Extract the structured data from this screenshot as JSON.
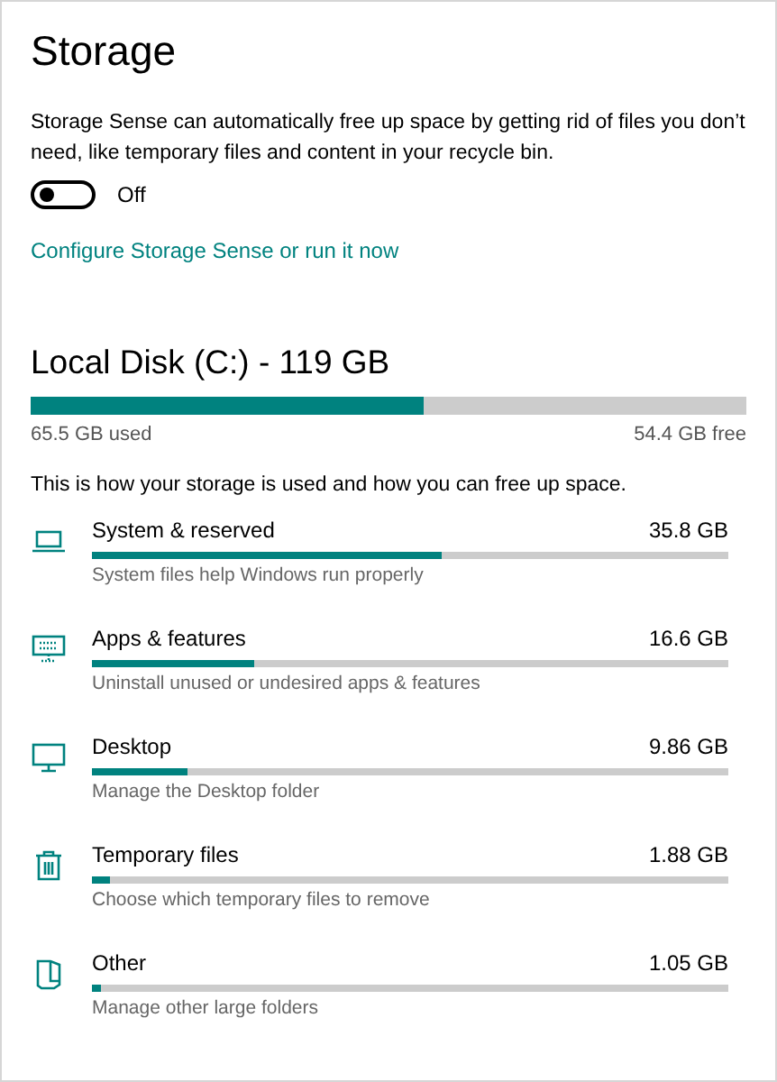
{
  "title": "Storage",
  "storage_sense": {
    "description": "Storage Sense can automatically free up space by getting rid of files you don’t need, like temporary files and content in your recycle bin.",
    "toggle": {
      "on": false,
      "label": "Off"
    },
    "link": "Configure Storage Sense or run it now"
  },
  "disk": {
    "title": "Local Disk (C:) - 119 GB",
    "level": 0.55,
    "used": "65.5 GB used",
    "free": "54.4 GB free",
    "description": "This is how your storage is used and how you can free up space."
  },
  "categories": [
    {
      "kind": "laptop",
      "name": "System & reserved",
      "size": "35.8 GB",
      "level": 0.55,
      "description": "System files help Windows run properly"
    },
    {
      "kind": "keyboard-monitor",
      "name": "Apps & features",
      "size": "16.6 GB",
      "level": 0.255,
      "description": "Uninstall unused or undesired apps & features"
    },
    {
      "kind": "monitor",
      "name": "Desktop",
      "size": "9.86 GB",
      "level": 0.15,
      "description": "Manage the Desktop folder"
    },
    {
      "kind": "trash",
      "name": "Temporary files",
      "size": "1.88 GB",
      "level": 0.028,
      "description": "Choose which temporary files to remove"
    },
    {
      "kind": "document",
      "name": "Other",
      "size": "1.05 GB",
      "level": 0.013,
      "description": "Manage other large folders"
    }
  ]
}
